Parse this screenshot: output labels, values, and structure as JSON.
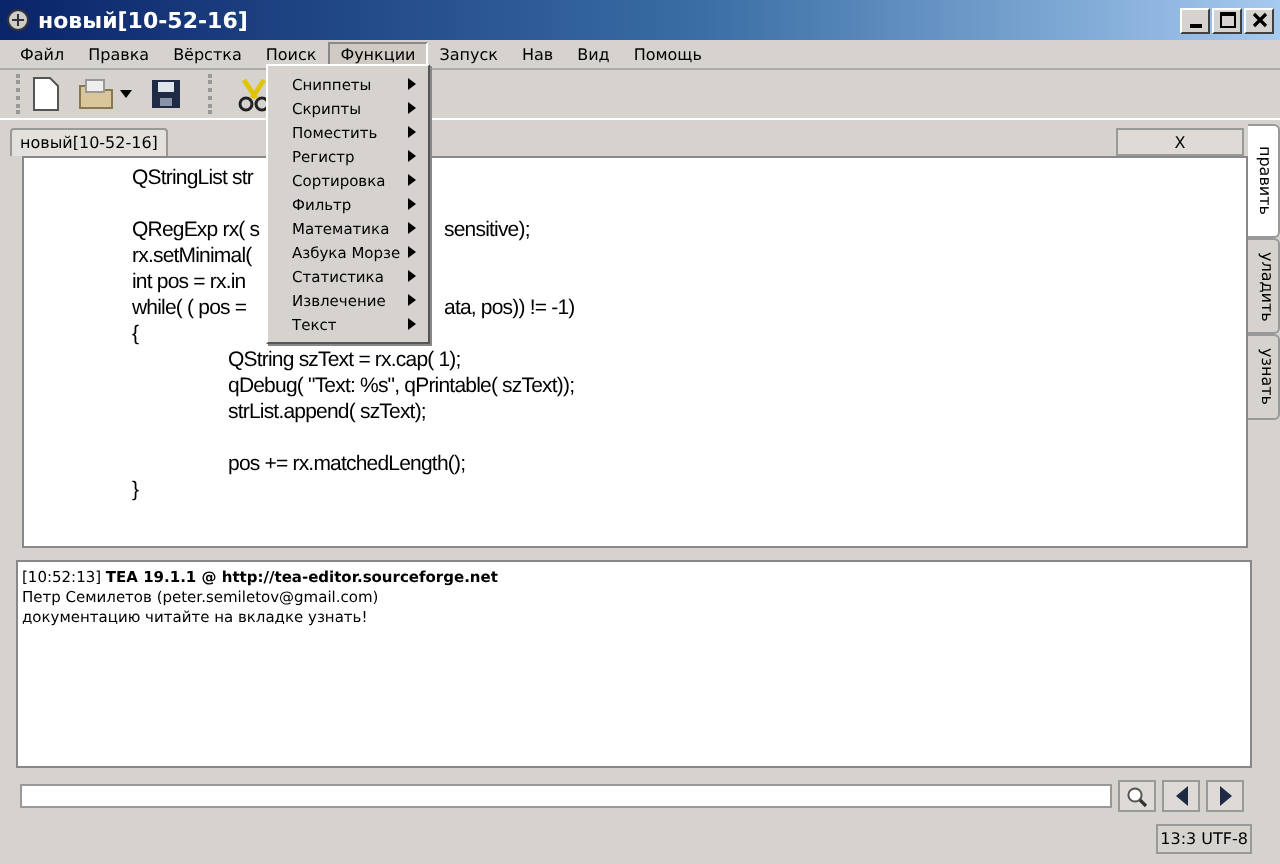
{
  "window": {
    "title": "новый[10-52-16]"
  },
  "menu_bar": [
    {
      "label": "Файл",
      "selected": false
    },
    {
      "label": "Правка",
      "selected": false
    },
    {
      "label": "Вёрстка",
      "selected": false
    },
    {
      "label": "Поиск",
      "selected": false
    },
    {
      "label": "Функции",
      "selected": true
    },
    {
      "label": "Запуск",
      "selected": false
    },
    {
      "label": "Нав",
      "selected": false
    },
    {
      "label": "Вид",
      "selected": false
    },
    {
      "label": "Помощь",
      "selected": false
    }
  ],
  "open_menu": {
    "items": [
      {
        "label": "Сниппеты"
      },
      {
        "label": "Скрипты"
      },
      {
        "label": "Поместить"
      },
      {
        "label": "Регистр"
      },
      {
        "label": "Сортировка"
      },
      {
        "label": "Фильтр"
      },
      {
        "label": "Математика"
      },
      {
        "label": "Азбука Морзе"
      },
      {
        "label": "Статистика"
      },
      {
        "label": "Извлечение"
      },
      {
        "label": "Текст"
      }
    ]
  },
  "document_tab": {
    "label": "новый[10-52-16]",
    "close_label": "X"
  },
  "side_tabs": [
    {
      "label": "править",
      "selected": true
    },
    {
      "label": "уладить",
      "selected": false
    },
    {
      "label": "узнать",
      "selected": false
    }
  ],
  "editor": {
    "blocks": [
      {
        "lines": [
          {
            "left": "\tQStringList str"
          }
        ]
      },
      {
        "lines": [
          {
            "left": "\tQRegExp rx( s",
            "right": "sensitive);"
          },
          {
            "left": "\trx.setMinimal("
          },
          {
            "left": "\tint pos = rx.in"
          },
          {
            "left": "\twhile( ( pos =",
            "right": "ata, pos)) != -1)"
          },
          {
            "left": "\t{"
          },
          {
            "left": "\t\tQString szText = rx.cap( 1);"
          },
          {
            "left": "\t\tqDebug( \"Text: %s\", qPrintable( szText));"
          },
          {
            "left": "\t\tstrList.append( szText);"
          }
        ]
      },
      {
        "lines": [
          {
            "left": "\t\tpos += rx.matchedLength();"
          },
          {
            "left": "\t}"
          }
        ]
      }
    ]
  },
  "log": [
    "[10:52:13] **TEA 19.1.1 @ http://tea-editor.sourceforge.net**",
    "Петр Семилетов (peter.semiletov@gmail.com)",
    "документацию читайте на вкладке узнать!"
  ],
  "status_bar": {
    "position": "13:3 UTF-8"
  }
}
